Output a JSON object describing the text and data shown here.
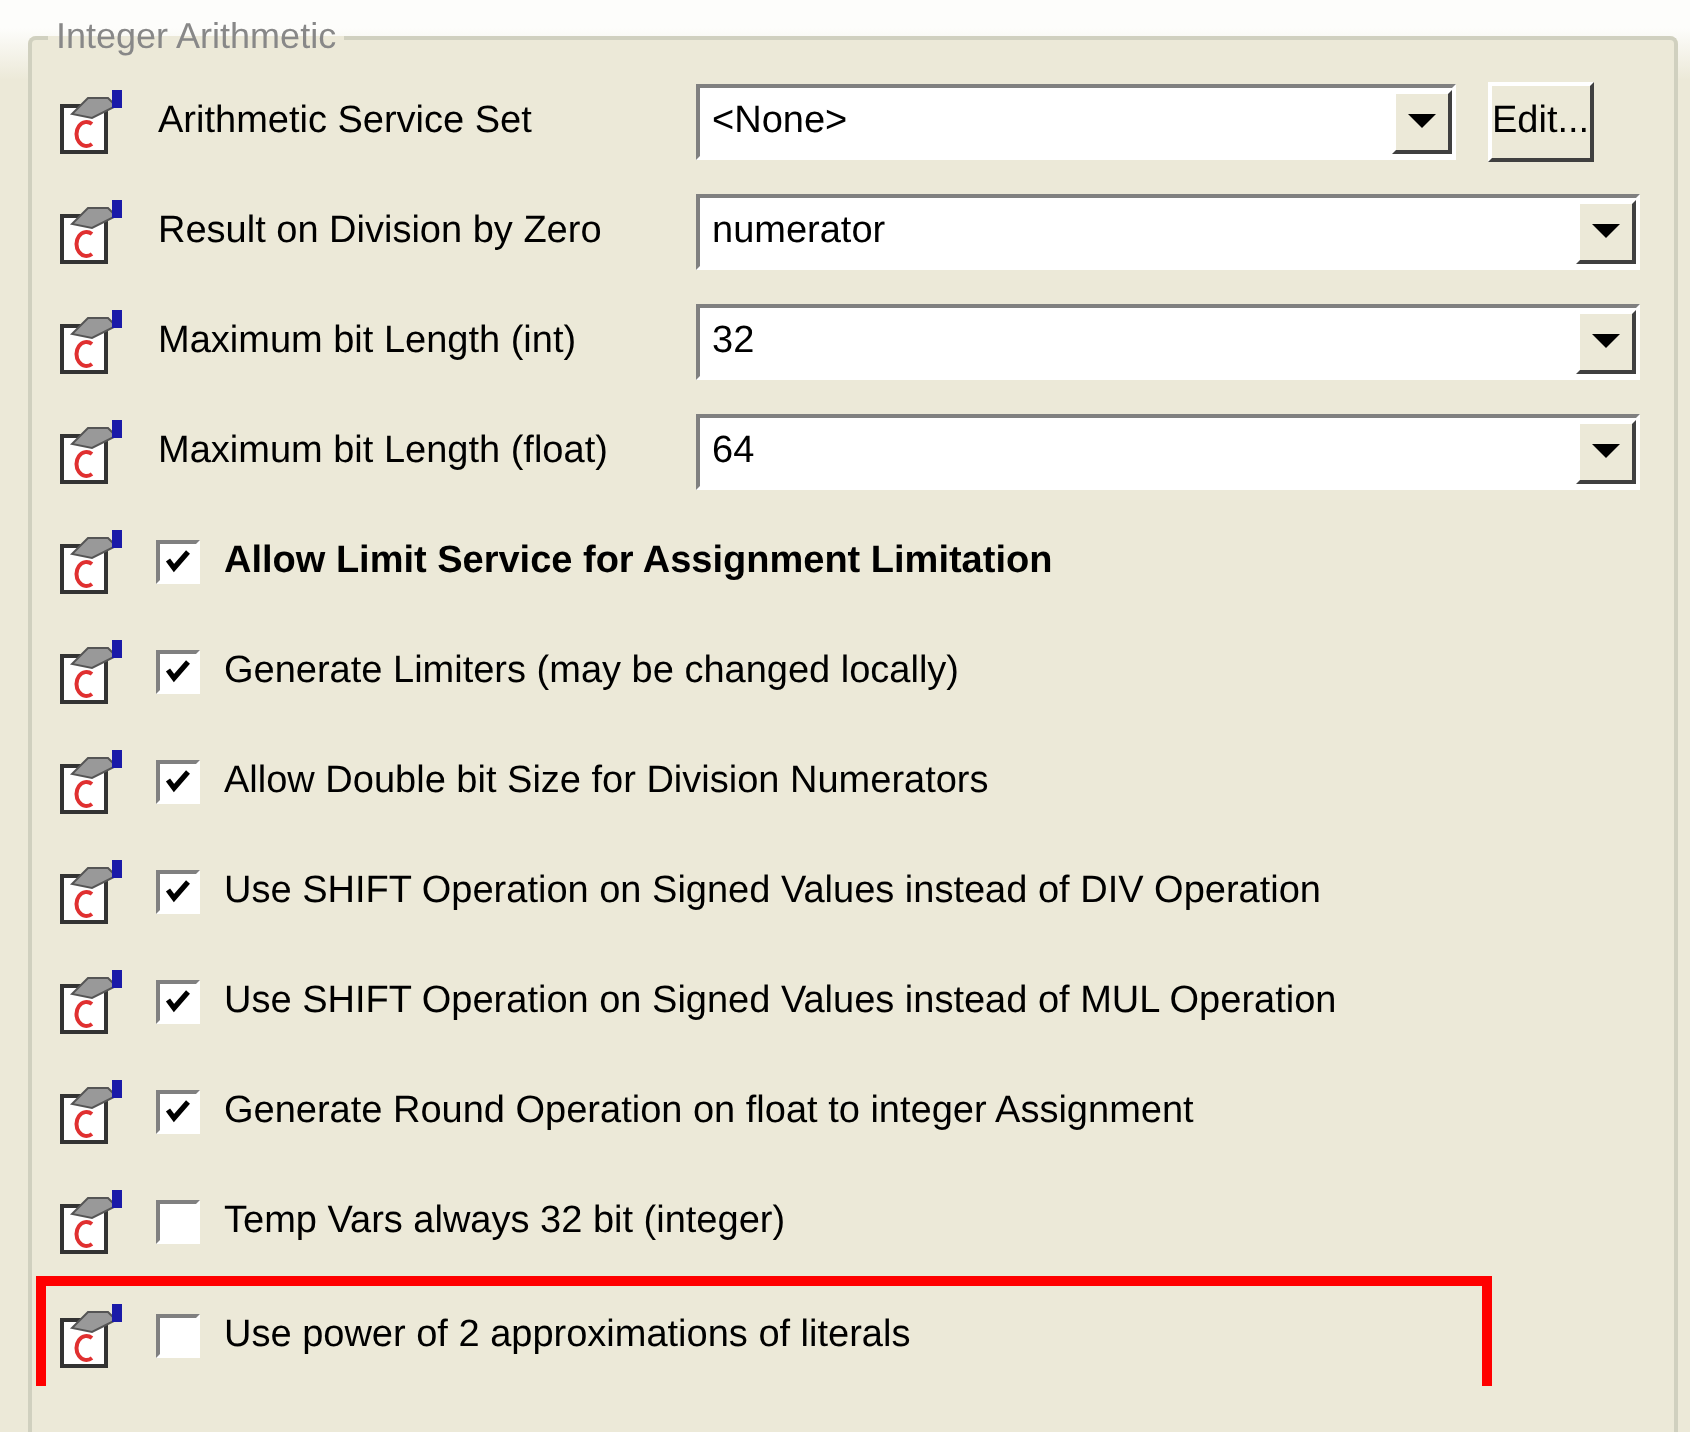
{
  "group": {
    "title": "Integer Arithmetic"
  },
  "settings": [
    {
      "kind": "combo",
      "label": "Arithmetic Service Set",
      "value": "<None>",
      "button": "Edit...",
      "highlighted": false
    },
    {
      "kind": "combo",
      "label": "Result on Division by Zero",
      "value": "numerator",
      "highlighted": false
    },
    {
      "kind": "combo",
      "label": "Maximum bit Length (int)",
      "value": "32",
      "highlighted": false
    },
    {
      "kind": "combo",
      "label": "Maximum bit Length (float)",
      "value": "64",
      "highlighted": false
    },
    {
      "kind": "check",
      "label": "Allow Limit Service for Assignment Limitation",
      "checked": true,
      "emphasized": true,
      "highlighted": false
    },
    {
      "kind": "check",
      "label": "Generate Limiters (may be changed locally)",
      "checked": true,
      "emphasized": false,
      "highlighted": false
    },
    {
      "kind": "check",
      "label": "Allow Double bit Size for Division Numerators",
      "checked": true,
      "emphasized": false,
      "highlighted": false
    },
    {
      "kind": "check",
      "label": "Use SHIFT Operation on Signed Values instead of DIV Operation",
      "checked": true,
      "emphasized": false,
      "highlighted": false
    },
    {
      "kind": "check",
      "label": "Use SHIFT Operation on Signed Values instead of MUL Operation",
      "checked": true,
      "emphasized": false,
      "highlighted": false
    },
    {
      "kind": "check",
      "label": "Generate Round Operation on float to integer Assignment",
      "checked": true,
      "emphasized": false,
      "highlighted": false
    },
    {
      "kind": "check",
      "label": "Temp Vars always 32 bit (integer)",
      "checked": false,
      "emphasized": false,
      "highlighted": false
    },
    {
      "kind": "check",
      "label": "Use power of 2 approximations of literals",
      "checked": false,
      "emphasized": false,
      "highlighted": true
    }
  ]
}
